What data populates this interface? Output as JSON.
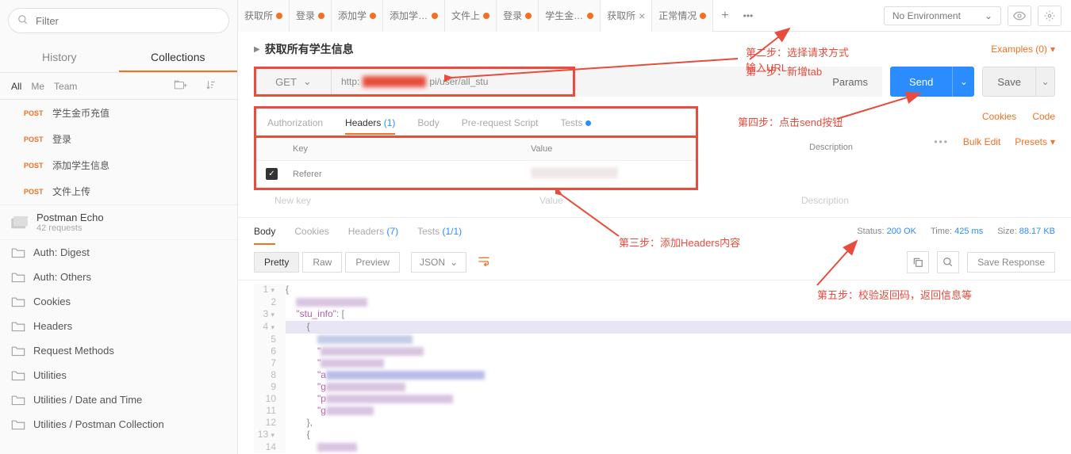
{
  "sidebar": {
    "filter_placeholder": "Filter",
    "tabs": {
      "history": "History",
      "collections": "Collections"
    },
    "scopes": {
      "all": "All",
      "me": "Me",
      "team": "Team"
    },
    "requests": [
      {
        "method": "POST",
        "name": "学生金币充值"
      },
      {
        "method": "POST",
        "name": "登录"
      },
      {
        "method": "POST",
        "name": "添加学生信息"
      },
      {
        "method": "POST",
        "name": "文件上传"
      }
    ],
    "echo": {
      "title": "Postman Echo",
      "sub": "42 requests"
    },
    "folders": [
      "Auth: Digest",
      "Auth: Others",
      "Cookies",
      "Headers",
      "Request Methods",
      "Utilities",
      "Utilities / Date and Time",
      "Utilities / Postman Collection"
    ]
  },
  "topTabs": [
    {
      "label": "获取所",
      "active": false,
      "dot": true
    },
    {
      "label": "登录",
      "active": false,
      "dot": true
    },
    {
      "label": "添加学",
      "active": false,
      "dot": true
    },
    {
      "label": "添加学生信",
      "active": false,
      "dot": true
    },
    {
      "label": "文件上",
      "active": false,
      "dot": true
    },
    {
      "label": "登录",
      "active": false,
      "dot": true
    },
    {
      "label": "学生金币充值",
      "active": false,
      "dot": true
    },
    {
      "label": "获取所",
      "active": true,
      "dot": false,
      "close": true
    },
    {
      "label": "正常情况",
      "active": false,
      "dot": true
    }
  ],
  "env": {
    "label": "No Environment"
  },
  "request": {
    "title": "获取所有学生信息",
    "examples": "Examples (0)",
    "method": "GET",
    "url_prefix": "http:",
    "url_suffix": "pi/user/all_stu",
    "params": "Params",
    "send": "Send",
    "save": "Save"
  },
  "reqTabs": {
    "auth": "Authorization",
    "headers": "Headers",
    "headers_count": "(1)",
    "body": "Body",
    "prescript": "Pre-request Script",
    "tests": "Tests"
  },
  "sideLinks": {
    "cookies": "Cookies",
    "code": "Code"
  },
  "headerTable": {
    "key": "Key",
    "value": "Value",
    "desc": "Description",
    "row_key": "Referer",
    "newkey": "New key",
    "newval": "Value",
    "newdesc": "Description",
    "bulk": "Bulk Edit",
    "presets": "Presets"
  },
  "resTabs": {
    "body": "Body",
    "cookies": "Cookies",
    "headers": "Headers",
    "headers_count": "(7)",
    "tests": "Tests",
    "tests_count": "(1/1)"
  },
  "resStatus": {
    "status_l": "Status:",
    "status_v": "200 OK",
    "time_l": "Time:",
    "time_v": "425 ms",
    "size_l": "Size:",
    "size_v": "88.17 KB"
  },
  "bodyCtrl": {
    "pretty": "Pretty",
    "raw": "Raw",
    "preview": "Preview",
    "fmt": "JSON",
    "save": "Save Response"
  },
  "code": {
    "key_stu": "\"stu_info\"",
    "brace_open": "{",
    "brace_close": "},",
    "arr_open": "[",
    "sub_open": "{"
  },
  "anno": {
    "s1": "第一步：新增tab",
    "s2a": "第二步：选择请求方式",
    "s2b": "输入URL",
    "s3": "第三步：添加Headers内容",
    "s4": "第四步：点击send按钮",
    "s5": "第五步：校验返回码，返回信息等"
  }
}
